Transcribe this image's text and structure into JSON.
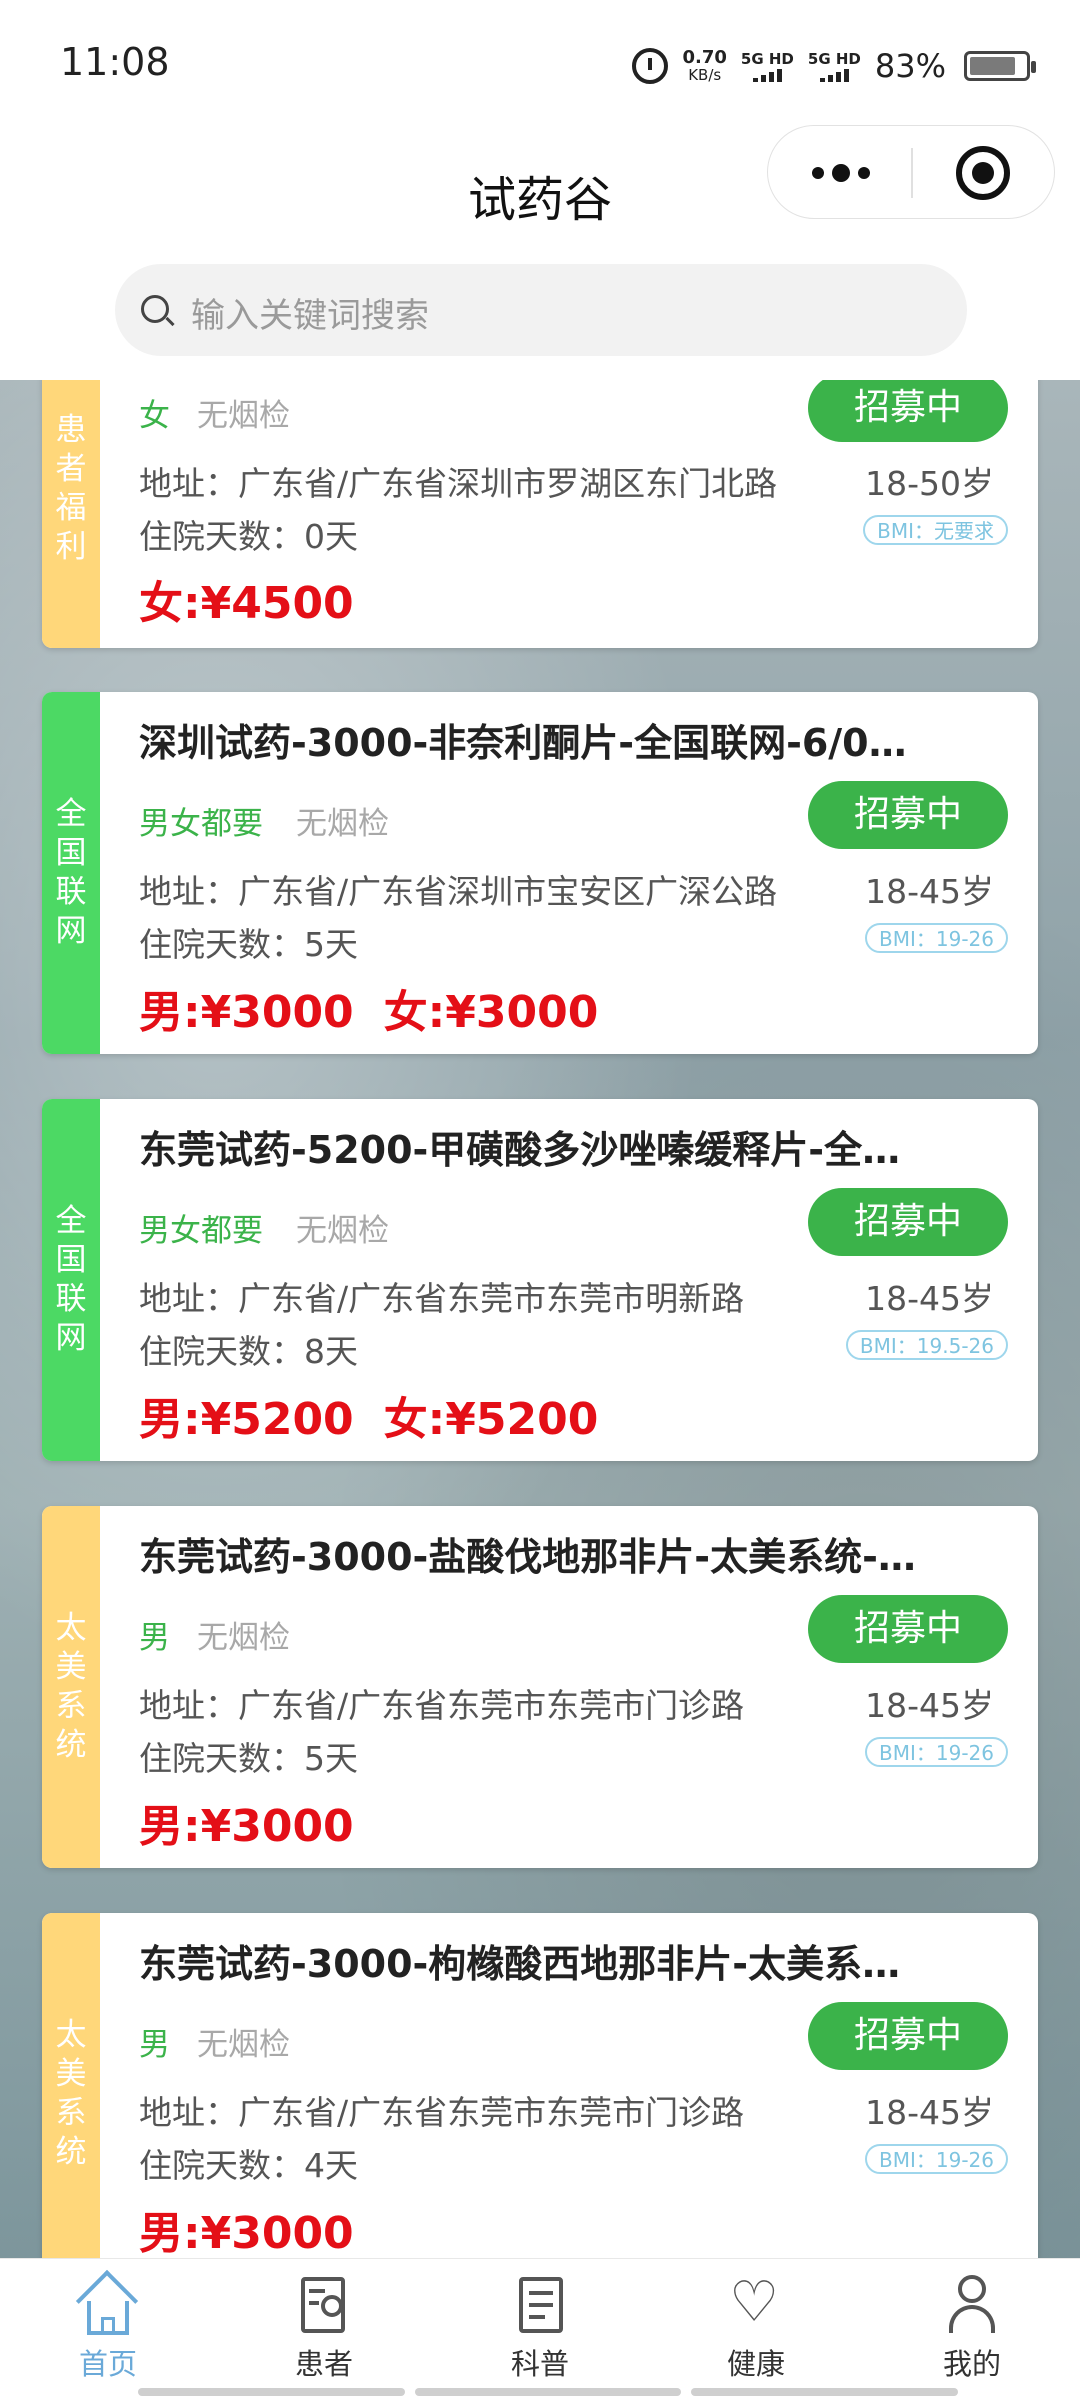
{
  "status_bar": {
    "time": "11:08",
    "net_speed": "0.70",
    "net_unit": "KB/s",
    "sim1": "5G HD",
    "sim2": "5G HD",
    "battery": "83%",
    "battery_level": 0.83
  },
  "header": {
    "title": "试药谷",
    "more_icon": "more-dots-icon",
    "close_icon": "target-icon"
  },
  "search": {
    "placeholder": "输入关键词搜索"
  },
  "colors": {
    "accent_green": "#3bb34a",
    "tag_yellow": "#ffd77a",
    "tag_green": "#4cd964",
    "price_red": "#e40f17",
    "tab_active": "#6aa9d8"
  },
  "cards": [
    {
      "tag": [
        "患",
        "者",
        "福",
        "利"
      ],
      "title": "",
      "gender": "女",
      "smoke": "无烟检",
      "status": "招募中",
      "address": "地址：广东省/广东省深圳市罗湖区东门北路",
      "age": "18-50岁",
      "days": "住院天数：0天",
      "bmi": "BMI：无要求",
      "price_male": "",
      "price_female": "女:¥4500"
    },
    {
      "tag": [
        "全",
        "国",
        "联",
        "网"
      ],
      "title": "深圳试药-3000-非奈利酮片-全国联网-6/0…",
      "gender": "男女都要",
      "smoke": "无烟检",
      "status": "招募中",
      "address": "地址：广东省/广东省深圳市宝安区广深公路",
      "age": "18-45岁",
      "days": "住院天数：5天",
      "bmi": "BMI：19-26",
      "price_male": "男:¥3000",
      "price_female": "女:¥3000"
    },
    {
      "tag": [
        "全",
        "国",
        "联",
        "网"
      ],
      "title": "东莞试药-5200-甲磺酸多沙唑嗪缓释片-全…",
      "gender": "男女都要",
      "smoke": "无烟检",
      "status": "招募中",
      "address": "地址：广东省/广东省东莞市东莞市明新路",
      "age": "18-45岁",
      "days": "住院天数：8天",
      "bmi": "BMI：19.5-26",
      "price_male": "男:¥5200",
      "price_female": "女:¥5200"
    },
    {
      "tag": [
        "太",
        "美",
        "系",
        "统"
      ],
      "title": "东莞试药-3000-盐酸伐地那非片-太美系统-…",
      "gender": "男",
      "smoke": "无烟检",
      "status": "招募中",
      "address": "地址：广东省/广东省东莞市东莞市门诊路",
      "age": "18-45岁",
      "days": "住院天数：5天",
      "bmi": "BMI：19-26",
      "price_male": "男:¥3000",
      "price_female": ""
    },
    {
      "tag": [
        "太",
        "美",
        "系",
        "统"
      ],
      "title": "东莞试药-3000-枸橼酸西地那非片-太美系…",
      "gender": "男",
      "smoke": "无烟检",
      "status": "招募中",
      "address": "地址：广东省/广东省东莞市东莞市门诊路",
      "age": "18-45岁",
      "days": "住院天数：4天",
      "bmi": "BMI：19-26",
      "price_male": "男:¥3000",
      "price_female": ""
    }
  ],
  "tabbar": {
    "items": [
      {
        "label": "首页",
        "icon": "home-icon",
        "active": true
      },
      {
        "label": "患者",
        "icon": "patient-icon",
        "active": false
      },
      {
        "label": "科普",
        "icon": "article-icon",
        "active": false
      },
      {
        "label": "健康",
        "icon": "heart-icon",
        "active": false
      },
      {
        "label": "我的",
        "icon": "user-icon",
        "active": false
      }
    ]
  }
}
